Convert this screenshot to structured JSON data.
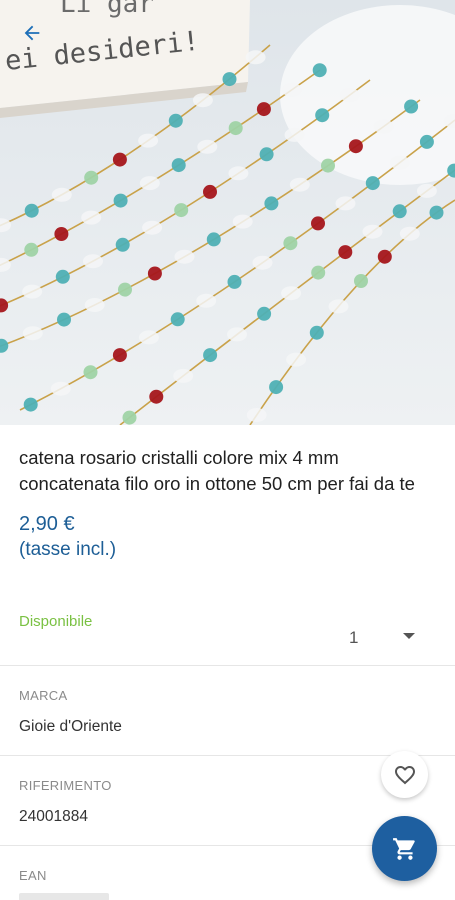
{
  "hero": {
    "image_icon": "product-photo",
    "caption_line1": "Li gar",
    "caption_line2": "ei desideri!"
  },
  "header": {
    "back_icon": "arrow-left-icon"
  },
  "product": {
    "title": "catena rosario cristalli colore mix 4 mm concatenata filo oro in ottone 50 cm per fai da te",
    "price": "2,90 €",
    "tax_note": "(tasse incl.)",
    "availability": "Disponibile",
    "quantity": "1"
  },
  "attributes": [
    {
      "label": "MARCA",
      "value": "Gioie d'Oriente"
    },
    {
      "label": "RIFERIMENTO",
      "value": "24001884"
    },
    {
      "label": "EAN",
      "value": ""
    }
  ],
  "actions": {
    "favorite_icon": "heart-outline-icon",
    "cart_icon": "cart-icon"
  },
  "colors": {
    "primary": "#1e5fa0",
    "price": "#1d5e96",
    "available": "#7ac143",
    "text": "#212121",
    "muted": "#8a8a8a"
  }
}
